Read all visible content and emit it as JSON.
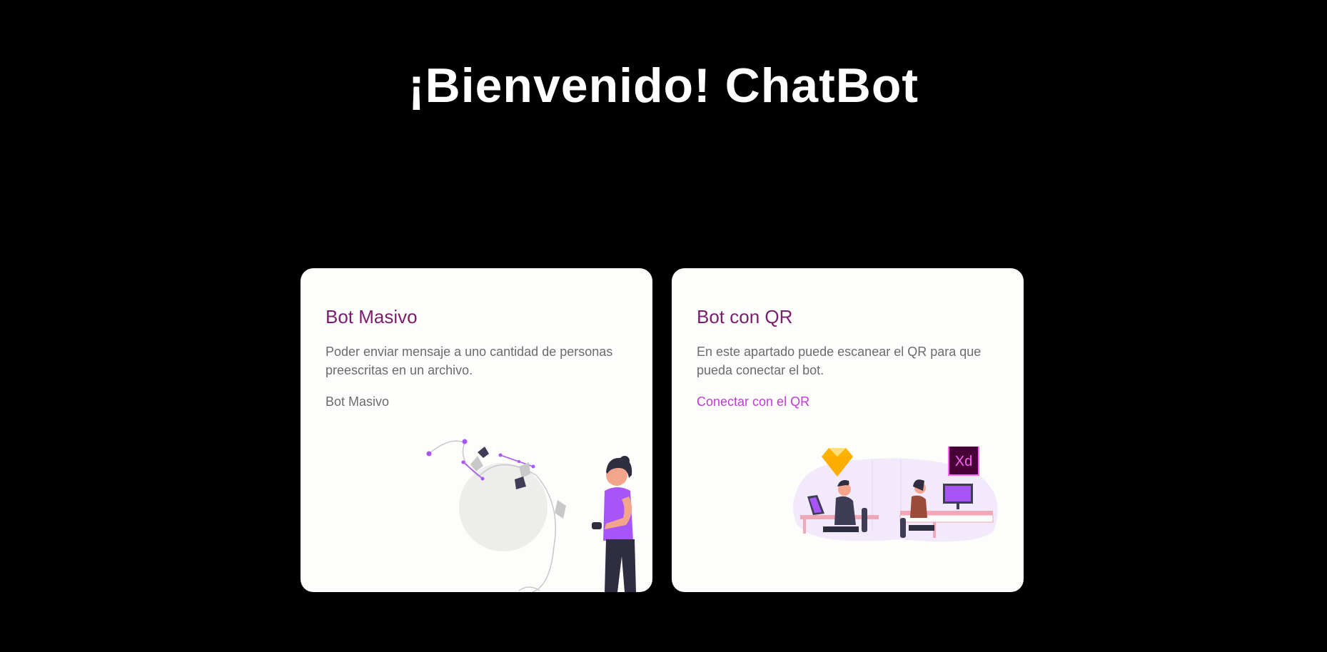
{
  "header": {
    "title": "¡Bienvenido! ChatBot"
  },
  "cards": [
    {
      "title": "Bot Masivo",
      "description": "Poder enviar mensaje a uno cantidad de personas preescritas en un archivo.",
      "link_label": "Bot Masivo",
      "illustration": "woman-pen-tool-illustration"
    },
    {
      "title": "Bot con QR",
      "description": "En este apartado puede escanear el QR para que pueda conectar el bot.",
      "link_label": "Conectar con el QR",
      "illustration": "designers-office-illustration",
      "badge_text": "Xd"
    }
  ],
  "colors": {
    "background": "#000000",
    "card": "#fdfdfb",
    "title": "#7a1f6e",
    "text": "#6b6b70",
    "accent": "#c03bd6",
    "purple": "#a855f7"
  }
}
